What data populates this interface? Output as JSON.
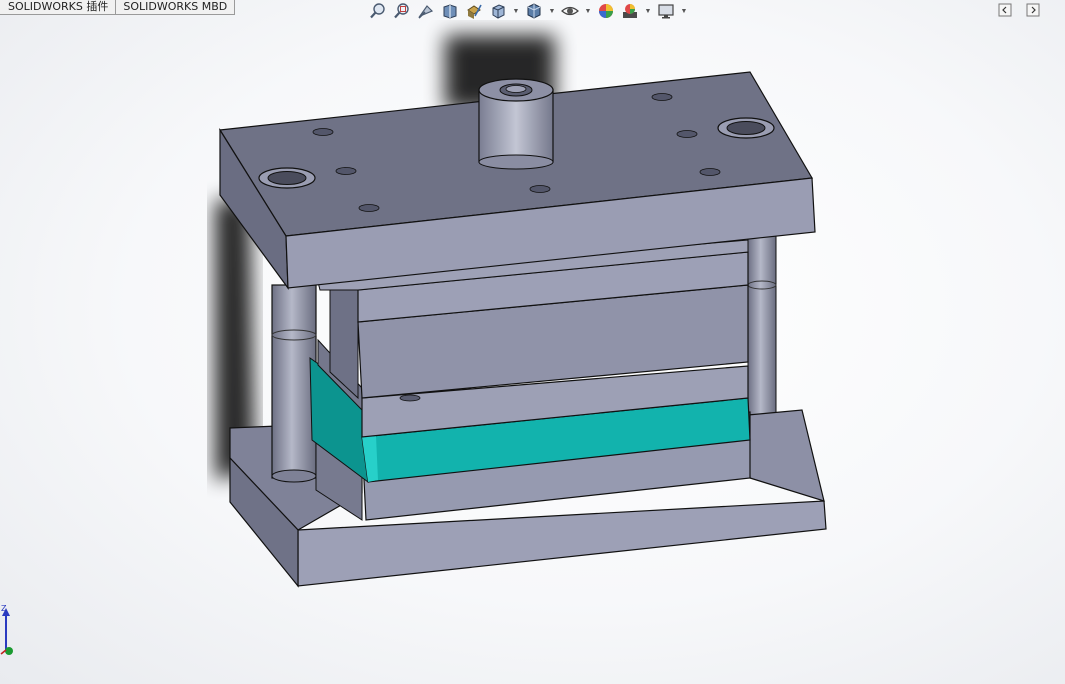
{
  "tabs": [
    "SOLIDWORKS 插件",
    "SOLIDWORKS MBD"
  ],
  "heads_up_toolbar": {
    "icons": [
      {
        "name": "zoom-to-fit-icon",
        "dropdown": false
      },
      {
        "name": "zoom-to-area-icon",
        "dropdown": false
      },
      {
        "name": "previous-view-icon",
        "dropdown": false
      },
      {
        "name": "section-view-icon",
        "dropdown": false
      },
      {
        "name": "dynamic-annotation-views-icon",
        "dropdown": false
      },
      {
        "name": "view-orientation-icon",
        "dropdown": true
      },
      {
        "name": "display-style-icon",
        "dropdown": true
      },
      {
        "name": "hide-show-items-icon",
        "dropdown": true
      },
      {
        "name": "edit-appearance-icon",
        "dropdown": false
      },
      {
        "name": "apply-scene-icon",
        "dropdown": true
      },
      {
        "name": "view-settings-icon",
        "dropdown": true
      }
    ]
  },
  "window_controls": [
    "restore-left-icon",
    "restore-right-icon"
  ],
  "triad": {
    "axis_label": "Z"
  },
  "colors": {
    "plate_top": "#8c8fa6",
    "plate_front": "#9a9db3",
    "plate_side": "#777a90",
    "accent_plate": "#12b3ad",
    "accent_plate_side": "#0c8e8a",
    "edge": "#111111"
  }
}
